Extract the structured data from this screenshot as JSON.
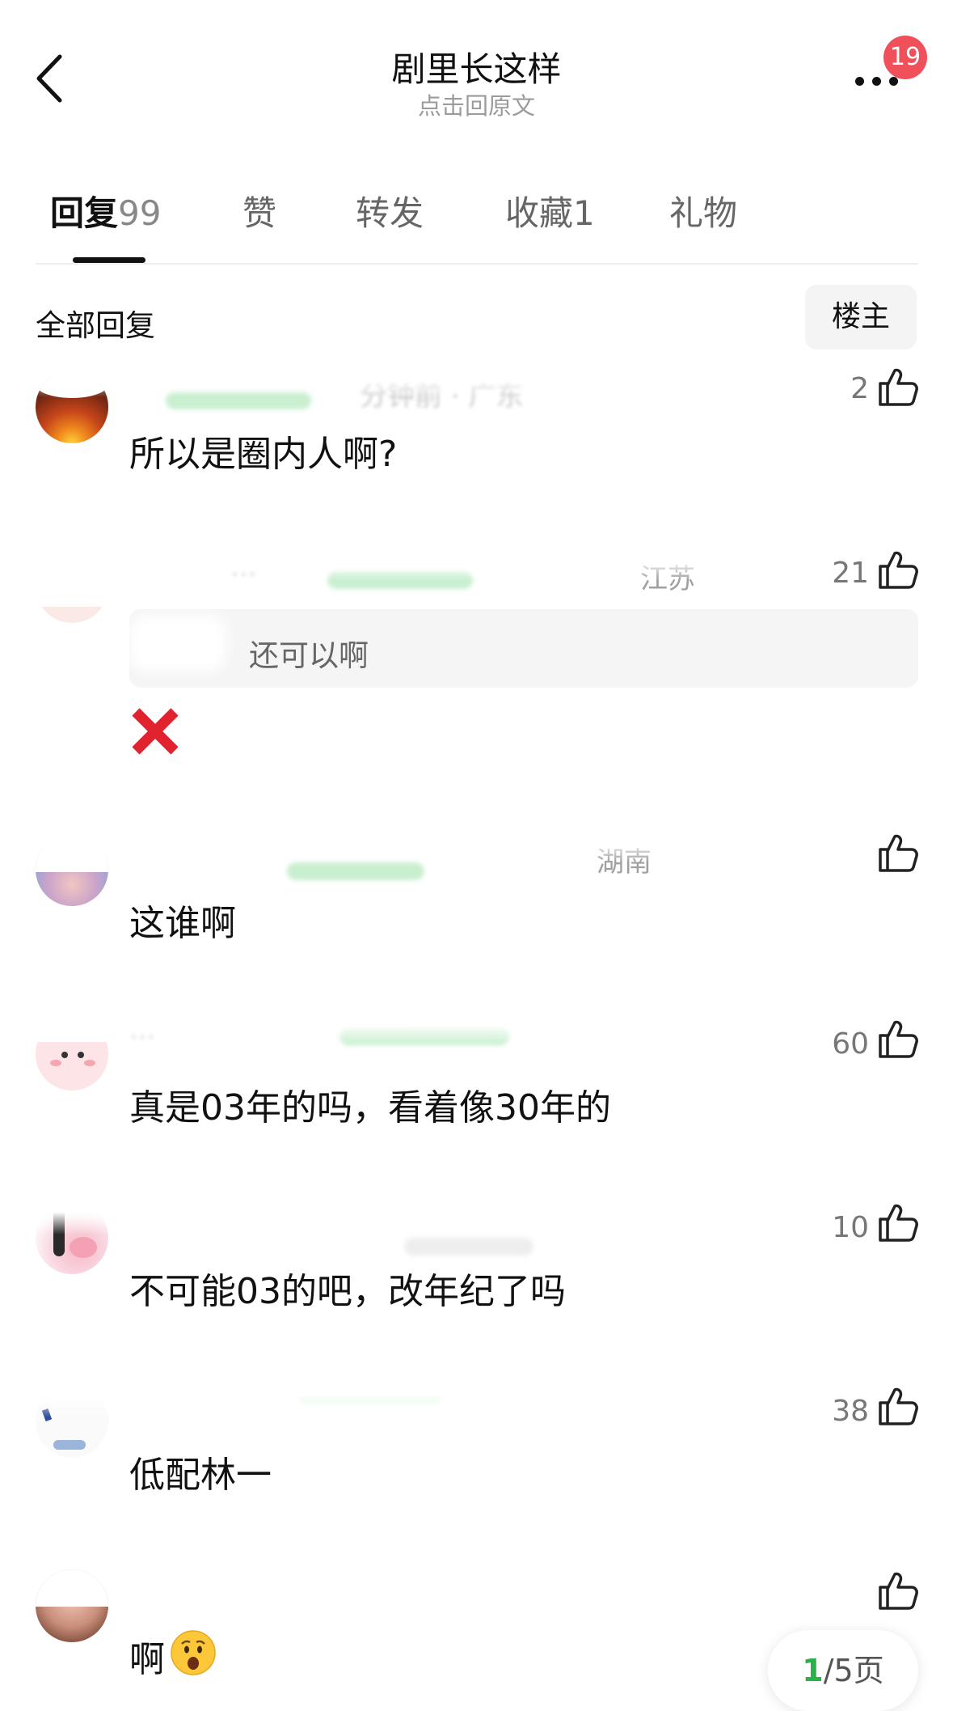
{
  "header": {
    "title": "剧里长这样",
    "subtitle": "点击回原文",
    "badge_count": "19"
  },
  "tabs": [
    {
      "label": "回复",
      "count": "99",
      "active": true
    },
    {
      "label": "赞",
      "count": ""
    },
    {
      "label": "转发",
      "count": ""
    },
    {
      "label": "收藏",
      "count": "1"
    },
    {
      "label": "礼物",
      "count": ""
    }
  ],
  "filter": {
    "all_replies_label": "全部回复",
    "op_button_label": "楼主"
  },
  "comments": [
    {
      "meta": "分钟前 · 广东",
      "text": "所以是圈内人啊?",
      "likes": "2"
    },
    {
      "meta": "江苏",
      "quote_text": "还可以啊",
      "likes": "21",
      "emoji_icon": "red-cross-mark"
    },
    {
      "meta": "湖南",
      "text": "这谁啊",
      "likes": ""
    },
    {
      "meta": "",
      "text": "真是03年的吗，看着像30年的",
      "likes": "60"
    },
    {
      "meta": "",
      "text": "不可能03的吧，改年纪了吗",
      "likes": "10"
    },
    {
      "meta": "",
      "text": "低配林一",
      "likes": "38"
    },
    {
      "meta": "",
      "text": "啊",
      "likes": "",
      "emoji_icon": "anguished-face-emoji"
    }
  ],
  "pager": {
    "current": "1",
    "total": "/5页"
  },
  "colors": {
    "badge": "#f0505a",
    "accent_green": "#2bb14a",
    "cross_red": "#e0232e"
  }
}
